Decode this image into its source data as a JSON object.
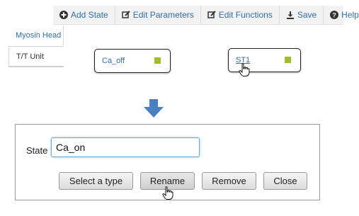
{
  "toolbar": {
    "add_state": "Add State",
    "edit_parameters": "Edit Parameters",
    "edit_functions": "Edit Functions",
    "save": "Save",
    "help": "Help"
  },
  "tabs": [
    {
      "label": "Myosin Head"
    },
    {
      "label": "T/T Unit"
    }
  ],
  "states": [
    {
      "label": "Ca_off"
    },
    {
      "label": "ST1"
    }
  ],
  "colors": {
    "link": "#2f6ea8",
    "state_marker": "#a2bd2a",
    "arrow": "#4a7fc1"
  },
  "dialog": {
    "state_label": "State",
    "state_value": "Ca_on",
    "buttons": {
      "select_type": "Select a type",
      "rename": "Rename",
      "remove": "Remove",
      "close": "Close"
    }
  },
  "icons": [
    "plus-circle-icon",
    "edit-icon",
    "edit-icon",
    "download-icon",
    "question-circle-icon",
    "hand-cursor-icon",
    "down-arrow-icon"
  ]
}
